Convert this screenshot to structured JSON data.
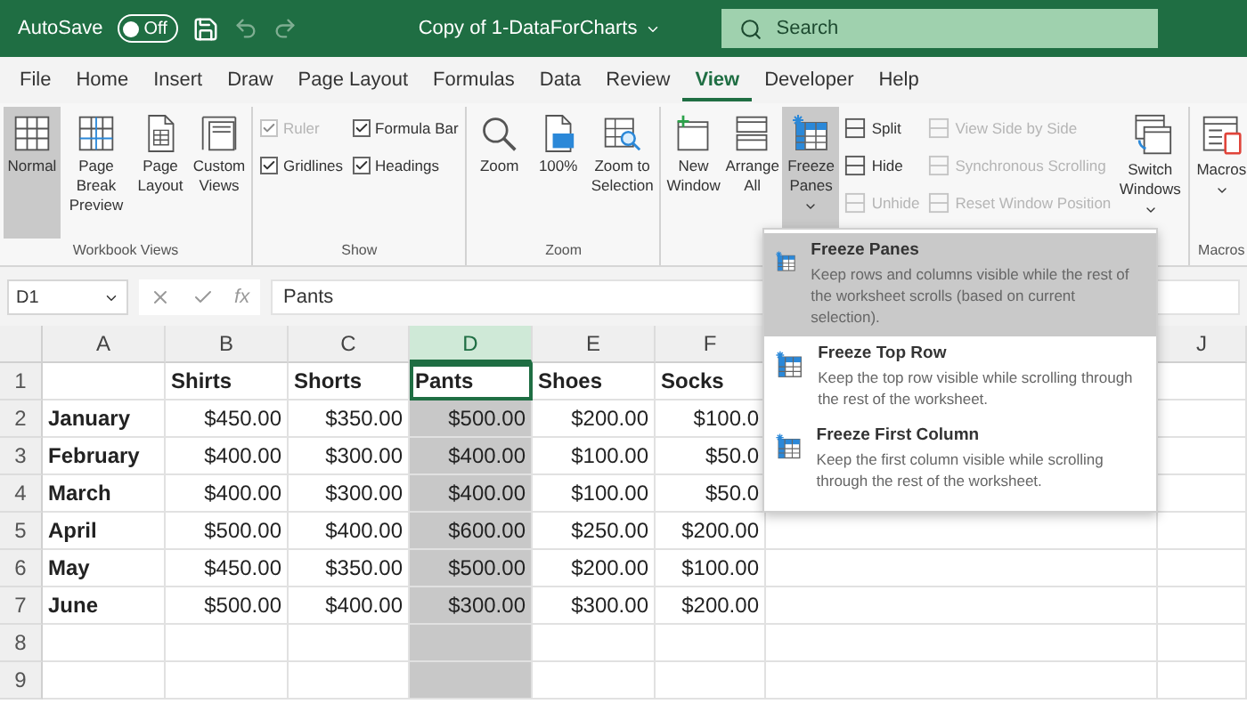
{
  "title_bar": {
    "autosave_label": "AutoSave",
    "autosave_toggle": {
      "label": "Off",
      "on": false
    },
    "document_title": "Copy of 1-DataForCharts",
    "search": {
      "placeholder": "Search"
    }
  },
  "menu_tabs": [
    {
      "label": "File",
      "selected": false
    },
    {
      "label": "Home",
      "selected": false
    },
    {
      "label": "Insert",
      "selected": false
    },
    {
      "label": "Draw",
      "selected": false
    },
    {
      "label": "Page Layout",
      "selected": false
    },
    {
      "label": "Formulas",
      "selected": false
    },
    {
      "label": "Data",
      "selected": false
    },
    {
      "label": "Review",
      "selected": false
    },
    {
      "label": "View",
      "selected": true
    },
    {
      "label": "Developer",
      "selected": false
    },
    {
      "label": "Help",
      "selected": false
    }
  ],
  "ribbon": {
    "groups": [
      {
        "label": "Workbook Views",
        "items": [
          {
            "kind": "large",
            "label": "Normal",
            "selected": true
          },
          {
            "kind": "large",
            "label": "Page Break Preview",
            "selected": false
          },
          {
            "kind": "large",
            "label": "Page Layout",
            "selected": false
          },
          {
            "kind": "large",
            "label": "Custom Views",
            "selected": false
          }
        ]
      },
      {
        "label": "Show",
        "items": [
          {
            "kind": "stack",
            "items": [
              {
                "kind": "checkbox",
                "label": "Ruler",
                "checked": true,
                "disabled": true
              },
              {
                "kind": "checkbox",
                "label": "Gridlines",
                "checked": true,
                "disabled": false
              }
            ]
          },
          {
            "kind": "stack",
            "items": [
              {
                "kind": "checkbox",
                "label": "Formula Bar",
                "checked": true,
                "disabled": false
              },
              {
                "kind": "checkbox",
                "label": "Headings",
                "checked": true,
                "disabled": false
              }
            ]
          }
        ]
      },
      {
        "label": "Zoom",
        "items": [
          {
            "kind": "large",
            "label": "Zoom",
            "selected": false
          },
          {
            "kind": "large",
            "label": "100%",
            "selected": false
          },
          {
            "kind": "large",
            "label": "Zoom to Selection",
            "selected": false
          }
        ]
      },
      {
        "items": [
          {
            "kind": "large",
            "label": "New Window",
            "selected": false
          },
          {
            "kind": "large",
            "label": "Arrange All",
            "selected": false
          },
          {
            "kind": "large",
            "label": "Freeze Panes",
            "selected": true,
            "dropdown": true
          },
          {
            "kind": "stack",
            "items": [
              {
                "kind": "small",
                "label": "Split",
                "disabled": false
              },
              {
                "kind": "small",
                "label": "Hide",
                "disabled": false
              },
              {
                "kind": "small",
                "label": "Unhide",
                "disabled": true
              }
            ]
          },
          {
            "kind": "stack",
            "items": [
              {
                "kind": "small",
                "label": "View Side by Side",
                "disabled": true
              },
              {
                "kind": "small",
                "label": "Synchronous Scrolling",
                "disabled": true
              },
              {
                "kind": "small",
                "label": "Reset Window Position",
                "disabled": true
              }
            ]
          },
          {
            "kind": "large",
            "label": "Switch Windows",
            "selected": false,
            "dropdown": true
          }
        ]
      },
      {
        "label": "Macros",
        "items": [
          {
            "kind": "large",
            "label": "Macros",
            "selected": false,
            "dropdown": true
          }
        ]
      }
    ]
  },
  "formula_bar": {
    "name_box": "D1",
    "function_symbol": "fx",
    "value": "Pants"
  },
  "sheet": {
    "columns": [
      {
        "label": "A",
        "selected": false
      },
      {
        "label": "B",
        "selected": false
      },
      {
        "label": "C",
        "selected": false
      },
      {
        "label": "D",
        "selected": true
      },
      {
        "label": "E",
        "selected": false
      },
      {
        "label": "F",
        "selected": false
      },
      {
        "label": "J",
        "selected": false
      }
    ],
    "rows": [
      {
        "header": "1",
        "active": true,
        "cells": [
          "",
          "Shirts",
          "Shorts",
          "Pants",
          "Shoes",
          "Socks",
          ""
        ]
      },
      {
        "header": "2",
        "active": false,
        "cells": [
          "January",
          "$450.00",
          "$350.00",
          "$500.00",
          "$200.00",
          "$100.0",
          ""
        ]
      },
      {
        "header": "3",
        "active": false,
        "cells": [
          "February",
          "$400.00",
          "$300.00",
          "$400.00",
          "$100.00",
          "$50.0",
          ""
        ]
      },
      {
        "header": "4",
        "active": false,
        "cells": [
          "March",
          "$400.00",
          "$300.00",
          "$400.00",
          "$100.00",
          "$50.0",
          ""
        ]
      },
      {
        "header": "5",
        "active": false,
        "cells": [
          "April",
          "$500.00",
          "$400.00",
          "$600.00",
          "$250.00",
          "$200.00",
          ""
        ]
      },
      {
        "header": "6",
        "active": false,
        "cells": [
          "May",
          "$450.00",
          "$350.00",
          "$500.00",
          "$200.00",
          "$100.00",
          ""
        ]
      },
      {
        "header": "7",
        "active": false,
        "cells": [
          "June",
          "$500.00",
          "$400.00",
          "$300.00",
          "$300.00",
          "$200.00",
          ""
        ]
      },
      {
        "header": "8",
        "active": false,
        "cells": [
          "",
          "",
          "",
          "",
          "",
          "",
          ""
        ]
      },
      {
        "header": "9",
        "active": false,
        "cells": [
          "",
          "",
          "",
          "",
          "",
          "",
          ""
        ]
      }
    ]
  },
  "freeze_menu": {
    "items": [
      {
        "title": "Freeze Panes",
        "description": "Keep rows and columns visible while the rest of the worksheet scrolls (based on current selection).",
        "selected": true
      },
      {
        "title": "Freeze Top Row",
        "description": "Keep the top row visible while scrolling through the rest of the worksheet.",
        "selected": false
      },
      {
        "title": "Freeze First Column",
        "description": "Keep the first column visible while scrolling through the rest of the worksheet.",
        "selected": false
      }
    ]
  }
}
